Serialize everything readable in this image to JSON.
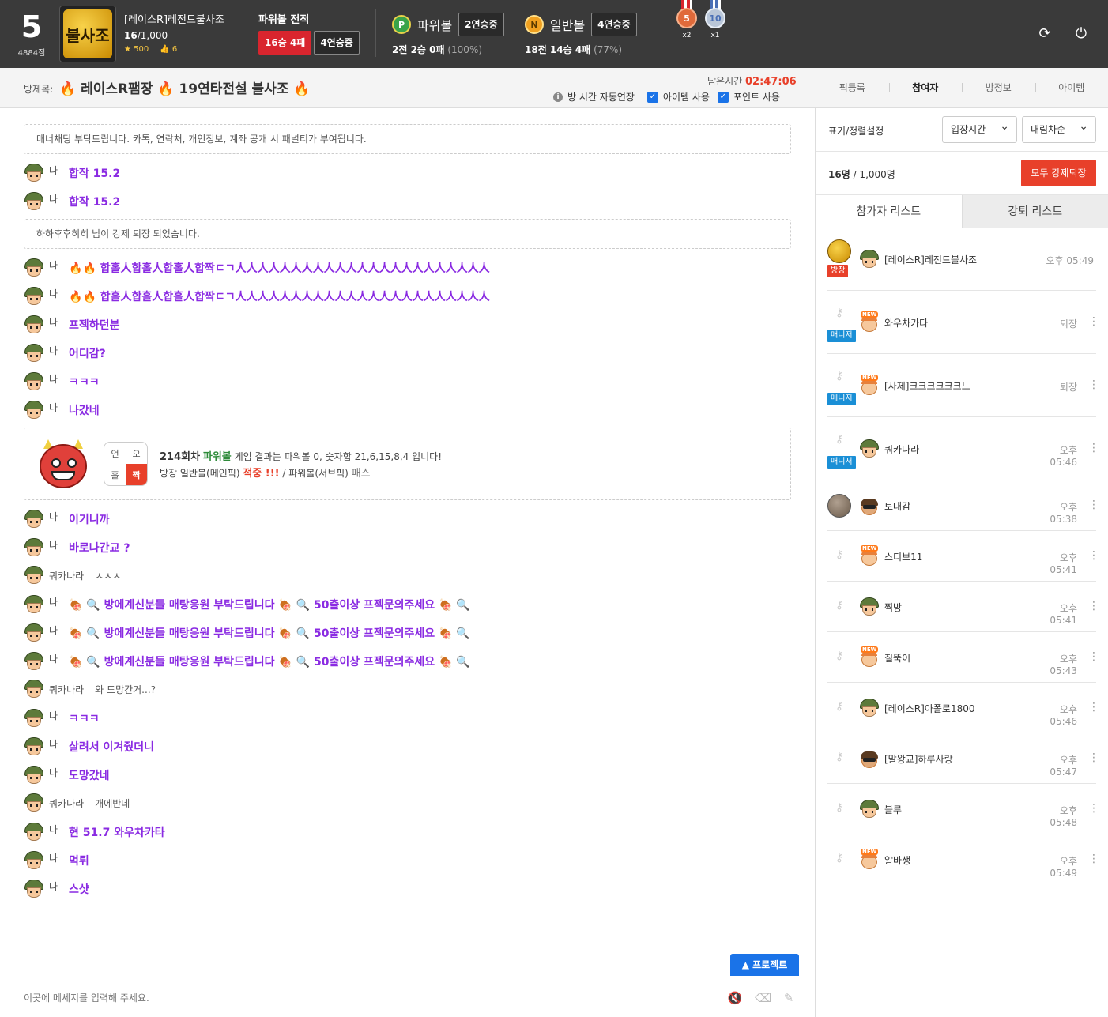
{
  "header": {
    "level": "5",
    "level_points": "4884점",
    "logo_text": "불사조",
    "profile_name": "[레이스R]레전드불사조",
    "member_count_current": "16",
    "member_count_total": "/1,000",
    "star_count": "500",
    "like_count": "6",
    "pb_record_title": "파워볼 전적",
    "pb_record_wl": "16승 4패",
    "pb_record_streak": "4연승중",
    "powerball": {
      "icon": "P",
      "name": "파워볼",
      "streak": "2연승중",
      "stat": "2전 2승 0패",
      "rate": "(100%)"
    },
    "normalball": {
      "icon": "N",
      "name": "일반볼",
      "streak": "4연승중",
      "stat": "18전 14승 4패",
      "rate": "(77%)"
    },
    "medals": [
      {
        "value": "5",
        "multiplier": "x2"
      },
      {
        "value": "10",
        "multiplier": "x1"
      }
    ],
    "icons": {
      "refresh": "refresh-icon",
      "power": "power-icon"
    }
  },
  "room": {
    "label": "방제목:",
    "title_parts": [
      "레이스R팸장",
      "19연타전설 불사조"
    ],
    "remain_label": "남은시간",
    "remain_time": "02:47:06",
    "auto_extend": "방 시간 자동연장",
    "item_use": "아이템 사용",
    "point_use": "포인트 사용",
    "tabs": [
      "픽등록",
      "참여자",
      "방정보",
      "아이템"
    ]
  },
  "chat": {
    "notice1": "매너채팅 부탁드립니다. 카톡, 연락처, 개인정보, 계좌 공개 시 패널티가 부여됩니다.",
    "notice2": "하하후후히히 님이 강제 퇴장 되었습니다.",
    "me": "나",
    "kuaka": "쿼카나라",
    "m1": "합작 15.2",
    "m2": "합작 15.2",
    "m3": "합홀人합홀人합홀人합짝ㄷㄱ人人人人人人人人人人人人人人人人人人人人人人人",
    "m4": "합홀人합홀人합홀人합짝ㄷㄱ人人人人人人人人人人人人人人人人人人人人人人人",
    "m5": "프젝하던분",
    "m6": "어디감?",
    "m7": "ㅋㅋㅋ",
    "m8": "나갔네",
    "result": {
      "round": "214회차",
      "game": "파워볼",
      "text1": "게임 결과는 파워볼 0, 숫자합 21,6,15,8,4 입니다!",
      "text2_a": "방장 일반볼(메인픽)",
      "hit": "적중 !!!",
      "text2_b": "/ 파워볼(서브픽)",
      "pass": "패스",
      "grid": [
        "언",
        "오",
        "홀",
        "짝"
      ]
    },
    "m9": "이기니까",
    "m10": "바로나간교 ?",
    "m11": "ㅅㅅㅅ",
    "m12a": "방에계신분들 매탕응원 부탁드립니다",
    "m12b": "50출이상 프젝문의주세요",
    "m15": "와 도망간거...?",
    "m16": "ㅋㅋㅋ",
    "m17": "살려서 이겨줬더니",
    "m18": "도망갔네",
    "m19": "개에반데",
    "m20": "현 51.7 와우차카타",
    "m21": "먹튀",
    "m22": "스샷",
    "protect_btn": "프로젝트",
    "input_placeholder": "이곳에 메세지를 입력해 주세요."
  },
  "panel": {
    "sort_label": "표기/정렬설정",
    "sort_field": "입장시간",
    "sort_order": "내림차순",
    "count_current": "16명",
    "count_total": "/ 1,000명",
    "kick_all": "모두 강제퇴장",
    "tab_participants": "참가자 리스트",
    "tab_kicked": "강퇴 리스트",
    "tag_owner": "방장",
    "tag_manager": "매니저",
    "participants": [
      {
        "name": "[레이스R]레전드불사조",
        "time": "오후 05:49"
      },
      {
        "name": "와우차카타",
        "time": "퇴장"
      },
      {
        "name": "[사제]크크크크크크느",
        "time": "퇴장"
      },
      {
        "name": "쿼카나라",
        "time": "오후 05:46"
      },
      {
        "name": "토대감",
        "time": "오후 05:38"
      },
      {
        "name": "스티브11",
        "time": "오후 05:41"
      },
      {
        "name": "찍방",
        "time": "오후 05:41"
      },
      {
        "name": "칠뚝이",
        "time": "오후 05:43"
      },
      {
        "name": "[레이스R]아폴로1800",
        "time": "오후 05:46"
      },
      {
        "name": "[말왕교]하루사랑",
        "time": "오후 05:47"
      },
      {
        "name": "블루",
        "time": "오후 05:48"
      },
      {
        "name": "알바생",
        "time": "오후 05:49"
      }
    ]
  }
}
